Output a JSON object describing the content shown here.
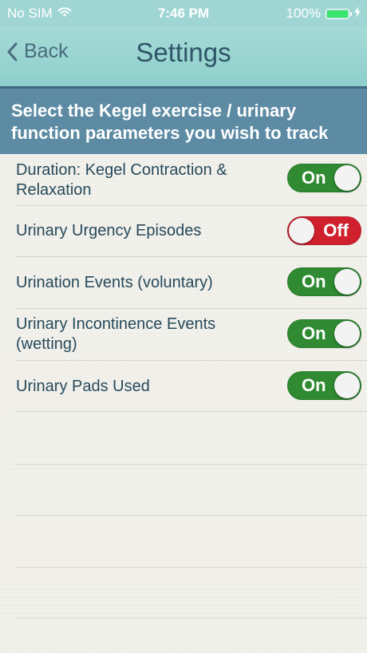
{
  "status_bar": {
    "carrier": "No SIM",
    "time": "7:46 PM",
    "battery_percent": "100%",
    "battery_color": "#39e66b",
    "wifi_icon": "wifi-icon",
    "charging_icon": "bolt-icon"
  },
  "nav": {
    "back_label": "Back",
    "title": "Settings"
  },
  "banner": {
    "text": "Select the Kegel exercise / urinary function parameters you wish to track"
  },
  "settings": [
    {
      "label": "Duration: Kegel Contraction & Relaxation",
      "state": "On"
    },
    {
      "label": "Urinary Urgency Episodes",
      "state": "Off"
    },
    {
      "label": "Urination Events (voluntary)",
      "state": "On"
    },
    {
      "label": "Urinary Incontinence Events (wetting)",
      "state": "On"
    },
    {
      "label": "Urinary Pads Used",
      "state": "On"
    }
  ],
  "colors": {
    "nav_bg": "#9fd6d3",
    "banner_bg": "#5c8ba3",
    "toggle_on": "#2f8a32",
    "toggle_off": "#d0202e",
    "label_text": "#274a5c"
  }
}
